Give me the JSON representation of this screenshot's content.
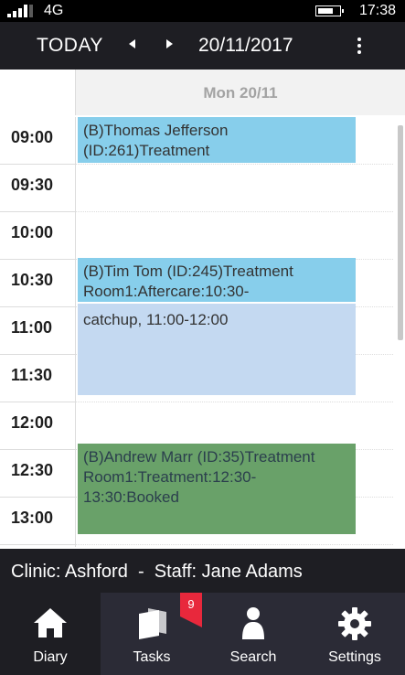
{
  "status_bar": {
    "network": "4G",
    "time": "17:38",
    "icons": [
      "signal-icon",
      "battery-icon"
    ]
  },
  "toolbar": {
    "today_label": "TODAY",
    "date": "20/11/2017",
    "icons": [
      "chevron-left-icon",
      "chevron-right-icon",
      "more-vertical-icon"
    ]
  },
  "day_header": {
    "label": "Mon 20/11"
  },
  "time_slots": [
    "09:00",
    "09:30",
    "10:00",
    "10:30",
    "11:00",
    "11:30",
    "12:00",
    "12:30",
    "13:00"
  ],
  "appointments": [
    {
      "lines": [
        "(B)Thomas Jefferson",
        "(ID:261)Treatment"
      ],
      "color": "#87CEEB"
    },
    {
      "lines": [
        "(B)Tim Tom (ID:245)Treatment",
        "Room1:Aftercare:10:30-"
      ],
      "color": "#87CEEB"
    },
    {
      "lines": [
        "catchup, 11:00-12:00"
      ],
      "color": "#C4D9F1"
    },
    {
      "lines": [
        "(B)Andrew Marr (ID:35)Treatment",
        "Room1:Treatment:12:30-",
        "13:30:Booked"
      ],
      "color": "#69A169"
    }
  ],
  "clinic_bar": {
    "clinic_label": "Clinic:",
    "clinic": "Ashford",
    "separator": "-",
    "staff_label": "Staff:",
    "staff": "Jane Adams"
  },
  "bottom_nav": {
    "items": [
      {
        "label": "Diary",
        "icon": "home-icon",
        "active": true
      },
      {
        "label": "Tasks",
        "icon": "tasks-icon",
        "badge": "9"
      },
      {
        "label": "Search",
        "icon": "person-icon"
      },
      {
        "label": "Settings",
        "icon": "gear-icon"
      }
    ],
    "badge_color": "#E8283C"
  }
}
